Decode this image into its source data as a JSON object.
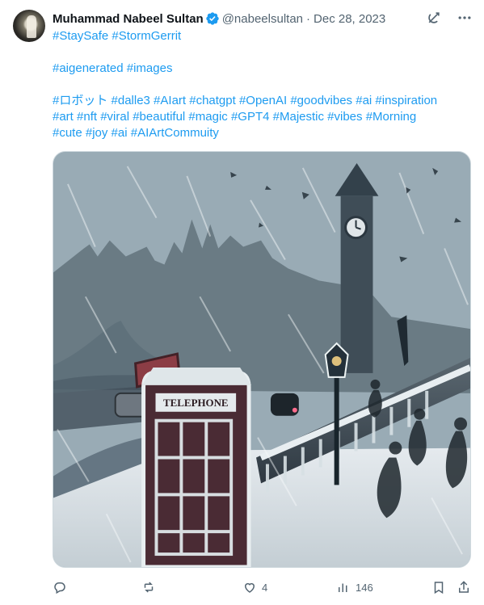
{
  "post": {
    "author": {
      "name": "Muhammad Nabeel Sultan",
      "handle": "@nabeelsultan",
      "separator": "·",
      "date": "Dec 28, 2023"
    },
    "text": {
      "line1": "#StaySafe #StormGerrit",
      "line2": "#aigenerated #images",
      "line3": " #ロボット #dalle3 #AIart #chatgpt #OpenAI #goodvibes #ai #inspiration",
      "line4": "#art #nft #viral #beautiful #magic #GPT4 #Majestic  #vibes #Morning",
      "line5": "#cute #joy #ai  #AIArtCommuity"
    },
    "media": {
      "sign_text": "TELEPHONE"
    },
    "actions": {
      "like_count": "4",
      "view_count": "146"
    },
    "icons": {
      "avatar": "avatar-image",
      "verified": "verified-badge-icon",
      "grok": "grok-icon",
      "more": "more-icon",
      "reply": "reply-icon",
      "repost": "repost-icon",
      "like": "heart-icon",
      "views": "views-chart-icon",
      "bookmark": "bookmark-icon",
      "share": "share-icon"
    },
    "colors": {
      "link": "#1d9bf0",
      "muted": "#536471",
      "text": "#0f1419",
      "verified": "#1d9bf0"
    }
  }
}
